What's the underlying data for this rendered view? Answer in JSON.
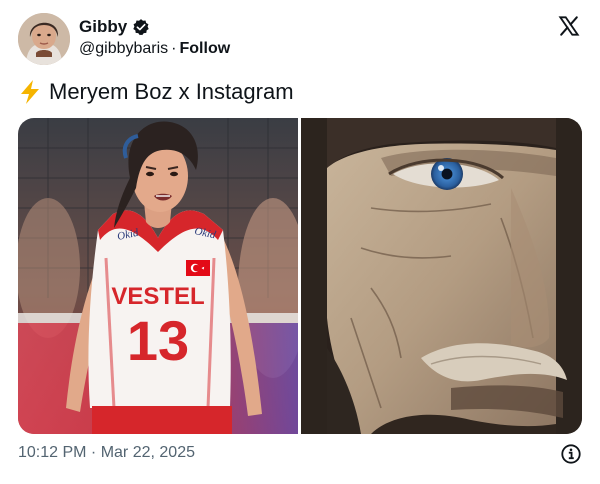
{
  "post": {
    "author": {
      "display_name": "Gibby",
      "handle": "@gibbybaris",
      "separator": "·",
      "follow_label": "Follow",
      "verified": true
    },
    "text": "Meryem Boz x Instagram",
    "emoji": "⚡",
    "media": {
      "left": {
        "jersey_brand": "VESTEL",
        "jersey_number": "13",
        "sleeve_logo": "Okid"
      },
      "right": {}
    },
    "timestamp": "10:12 PM · Mar 22, 2025"
  },
  "colors": {
    "text": "#0f1419",
    "secondary": "#536471",
    "bolt": "#f5b400",
    "jersey_red": "#d6262b"
  },
  "icons": [
    "verified-badge-icon",
    "x-logo-icon",
    "lightning-bolt-icon",
    "info-icon"
  ]
}
